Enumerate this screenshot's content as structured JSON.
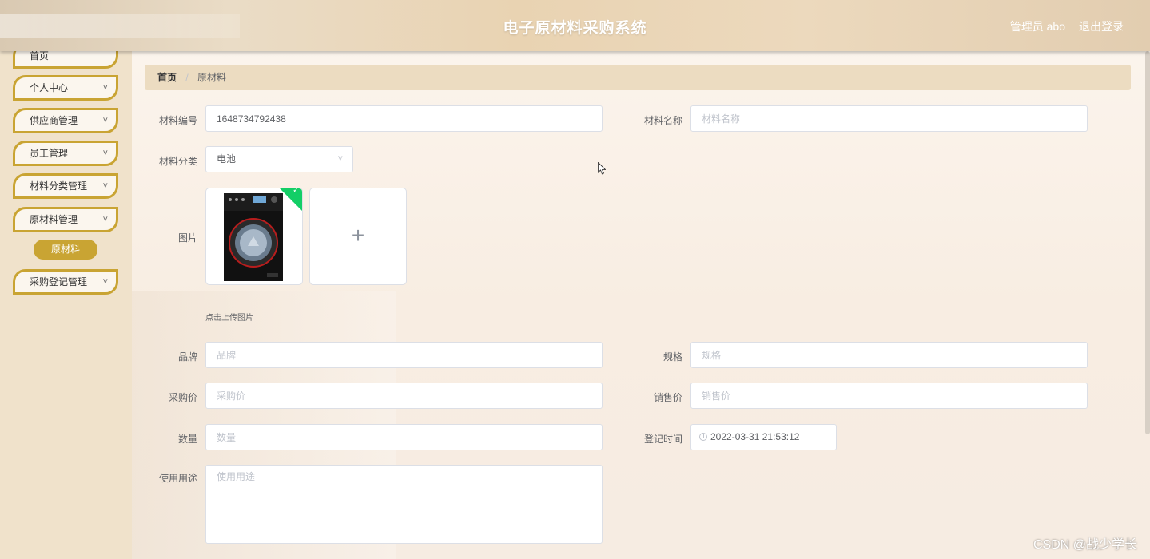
{
  "header": {
    "title": "电子原材料采购系统",
    "user": "管理员 abo",
    "logout": "退出登录"
  },
  "sidebar": {
    "items": [
      {
        "label": "首页"
      },
      {
        "label": "个人中心",
        "chevron": "˅"
      },
      {
        "label": "供应商管理",
        "chevron": "˅"
      },
      {
        "label": "员工管理",
        "chevron": "˅"
      },
      {
        "label": "材料分类管理",
        "chevron": "˅"
      },
      {
        "label": "原材料管理",
        "chevron": "˅"
      },
      {
        "label": "采购登记管理",
        "chevron": "˅"
      }
    ],
    "active_sub": "原材料"
  },
  "breadcrumb": {
    "home": "首页",
    "separator": "/",
    "current": "原材料"
  },
  "form": {
    "code": {
      "label": "材料编号",
      "value": "1648734792438"
    },
    "name": {
      "label": "材料名称",
      "placeholder": "材料名称"
    },
    "category": {
      "label": "材料分类",
      "value": "电池"
    },
    "image": {
      "label": "图片",
      "hint": "点击上传图片",
      "plus": "+",
      "check": "✓"
    },
    "brand": {
      "label": "品牌",
      "placeholder": "品牌"
    },
    "spec": {
      "label": "规格",
      "placeholder": "规格"
    },
    "purchase_price": {
      "label": "采购价",
      "placeholder": "采购价"
    },
    "sale_price": {
      "label": "销售价",
      "placeholder": "销售价"
    },
    "quantity": {
      "label": "数量",
      "placeholder": "数量"
    },
    "reg_time": {
      "label": "登记时间",
      "value": "2022-03-31 21:53:12"
    },
    "usage": {
      "label": "使用用途",
      "placeholder": "使用用途"
    }
  },
  "watermark": "CSDN @战少学长",
  "colors": {
    "accent": "#c9a433",
    "success": "#13ce66"
  }
}
